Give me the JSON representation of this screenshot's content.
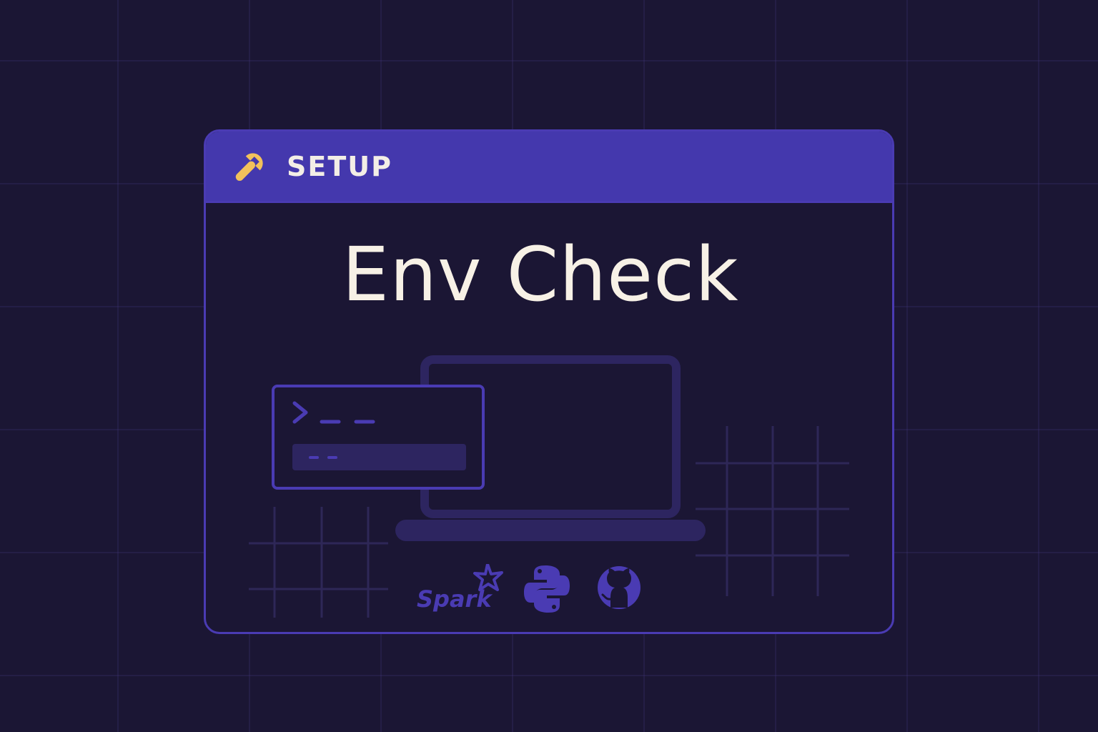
{
  "header": {
    "label": "SETUP",
    "icon": "wrench-icon",
    "icon_color": "#f2c15b",
    "background_color": "#4438ad"
  },
  "title": "Env Check",
  "illustration": {
    "terminal_window_icon": "terminal-prompt-icon",
    "laptop_icon": "laptop-icon"
  },
  "logos": {
    "spark": {
      "text": "Spark",
      "icon": "spark-star-icon"
    },
    "python": {
      "icon": "python-icon"
    },
    "github": {
      "icon": "github-icon"
    }
  },
  "colors": {
    "background": "#1b1634",
    "accent": "#4a3bb3",
    "title_text": "#f7f1e6"
  }
}
